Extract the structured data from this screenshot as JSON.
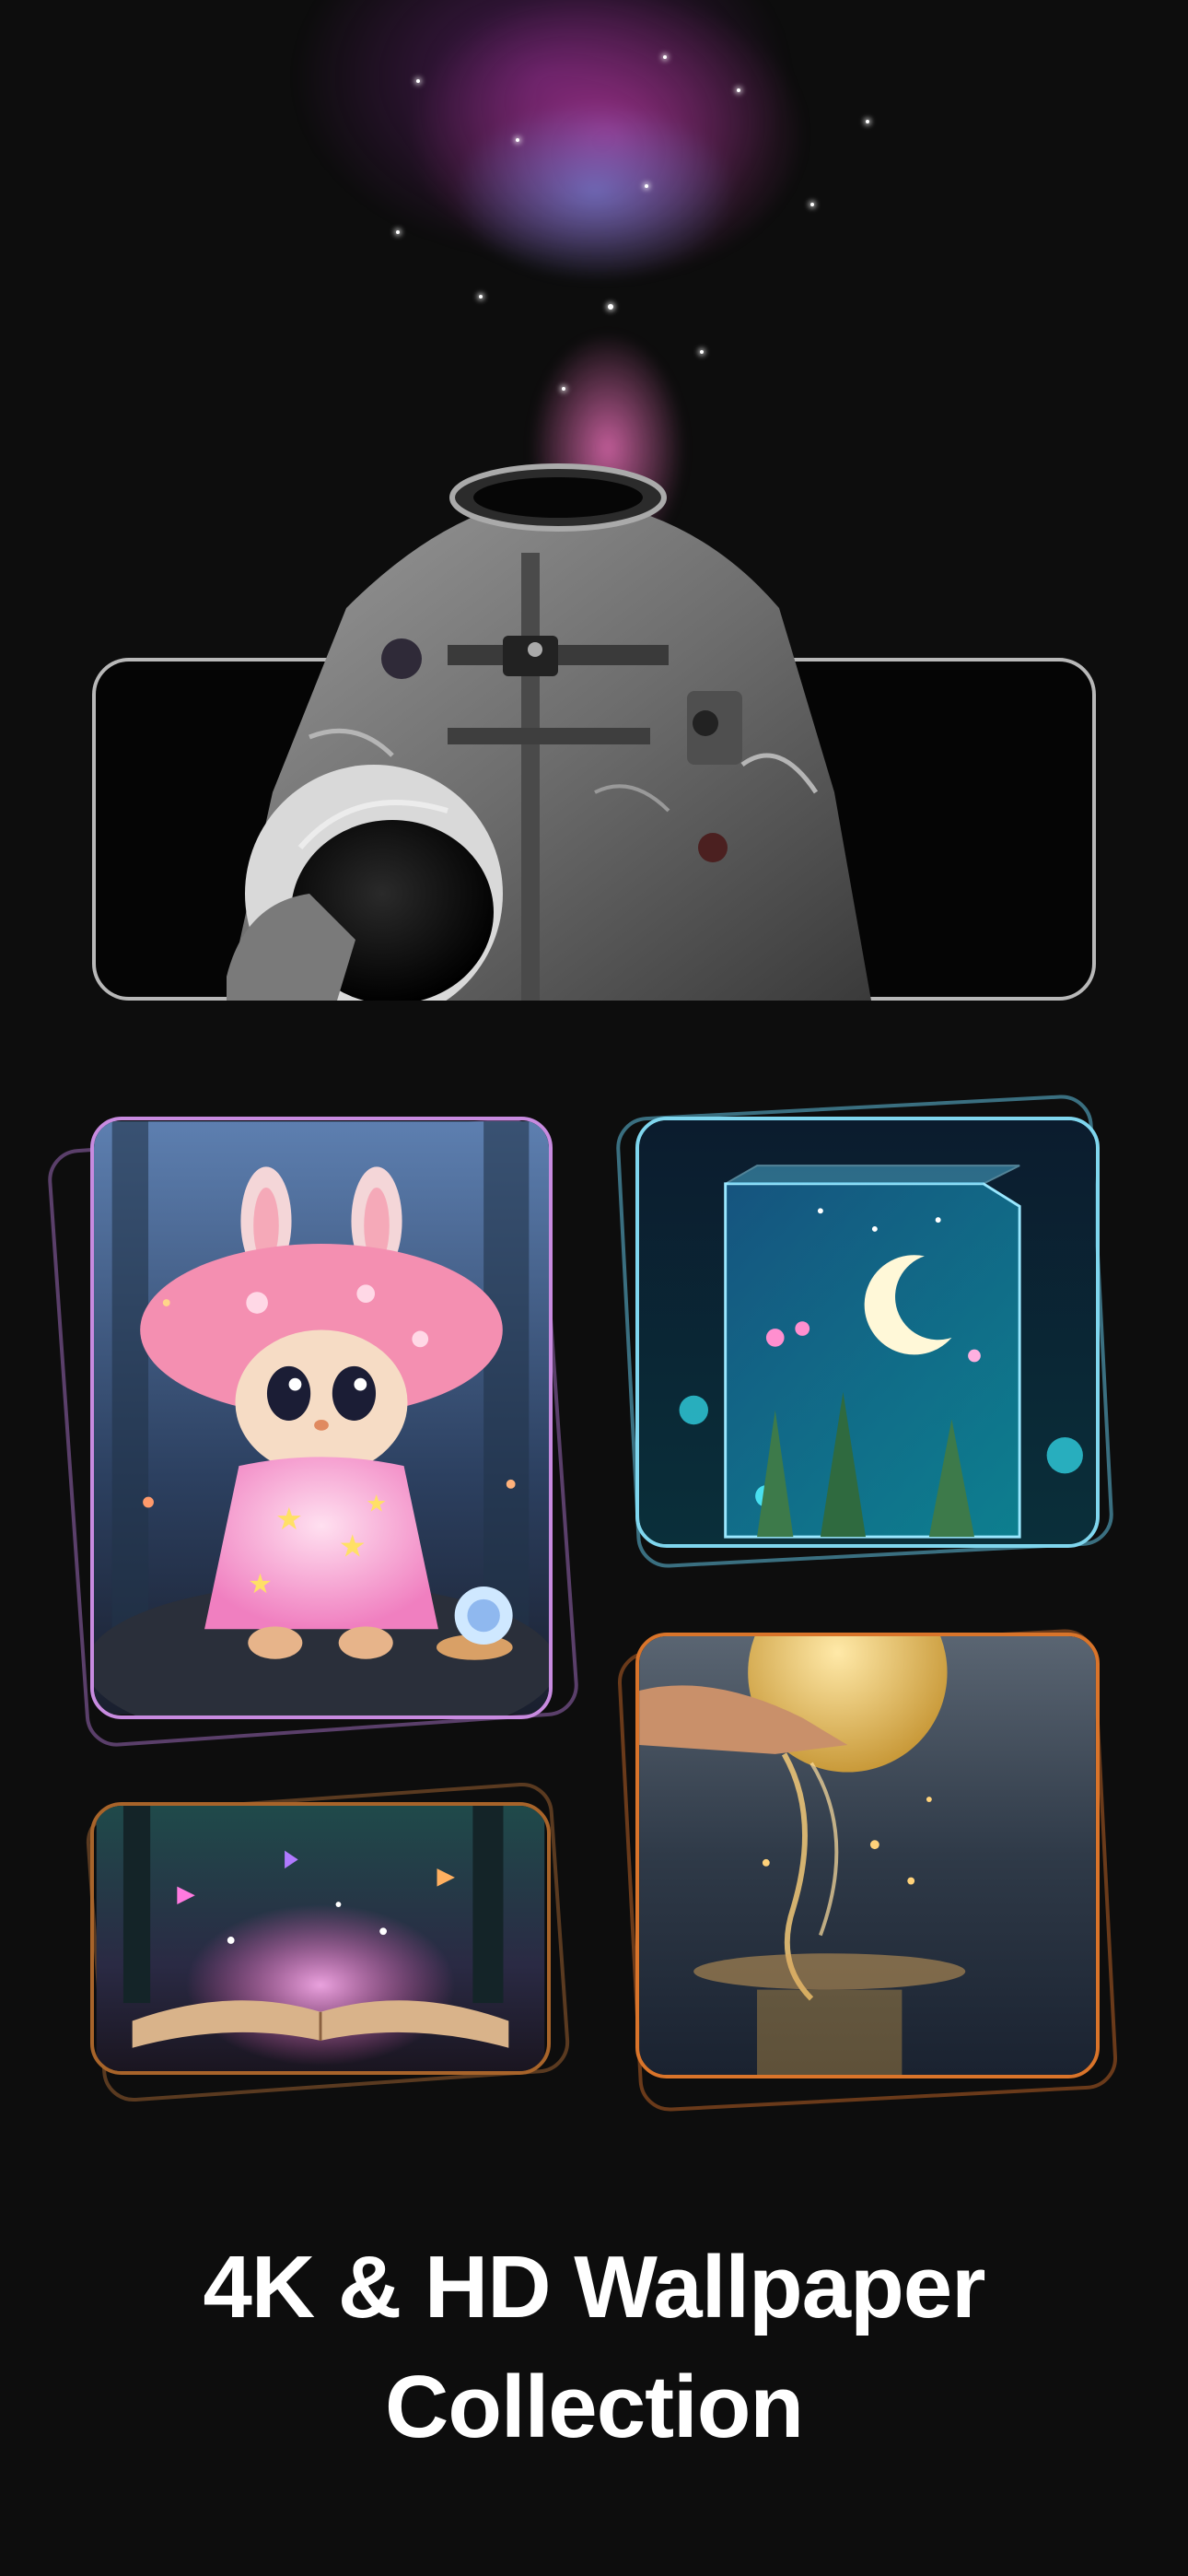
{
  "hero": {
    "image": "astronaut-galaxy-wallpaper"
  },
  "gallery": {
    "tiles": [
      {
        "image": "mushroom-bunny-toy-wallpaper",
        "accent": "#c88be0"
      },
      {
        "image": "glass-box-moon-wallpaper",
        "accent": "#7fd6ee"
      },
      {
        "image": "moon-water-hand-wallpaper",
        "accent": "#d9742a"
      },
      {
        "image": "magic-book-forest-wallpaper",
        "accent": "#a8642a"
      }
    ]
  },
  "caption": {
    "line1": "4K & HD Wallpaper",
    "line2": "Collection"
  },
  "colors": {
    "background": "#0d0d0d",
    "text": "#ffffff",
    "frame": "#b8b8b8"
  }
}
